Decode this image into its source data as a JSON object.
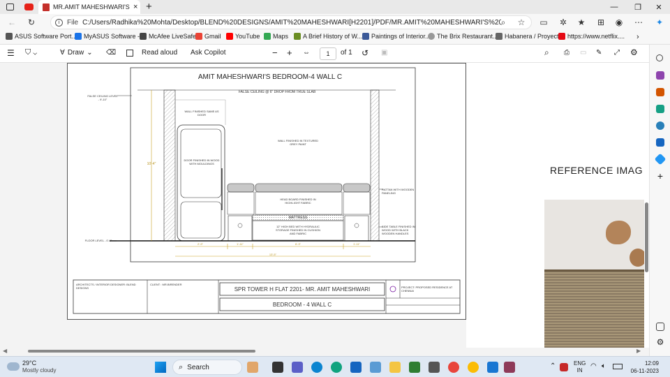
{
  "window": {
    "tab_title": "MR.AMIT MAHESHWARI'S BEDR...",
    "tab_close": "×",
    "new_tab": "+"
  },
  "address": {
    "file_label": "File",
    "url": "C:/Users/Radhika%20Mohta/Desktop/BLEND%20DESIGNS/AMIT%20MAHESHWARI[H2201]/PDF/MR.AMIT%20MAHESHWARI'S%20BEDROOM-4.pdf"
  },
  "bookmarks": [
    {
      "label": "ASUS Software Port...",
      "color": "#555555"
    },
    {
      "label": "MyASUS Software -...",
      "color": "#1a73e8"
    },
    {
      "label": "McAfee LiveSafe",
      "color": "#444444"
    },
    {
      "label": "Gmail",
      "color": "#ea4335"
    },
    {
      "label": "YouTube",
      "color": "#ff0000"
    },
    {
      "label": "Maps",
      "color": "#34a853"
    },
    {
      "label": "A Brief History of W...",
      "color": "#6b8e23"
    },
    {
      "label": "Paintings of Interior...",
      "color": "#3b5998"
    },
    {
      "label": "The Brix Restaurant...",
      "color": "#999999"
    },
    {
      "label": "Habanera / Proyect...",
      "color": "#666666"
    },
    {
      "label": "https://www.netflix....",
      "color": "#e50914"
    }
  ],
  "pdf_toolbar": {
    "draw": "Draw",
    "read_aloud": "Read aloud",
    "ask_copilot": "Ask Copilot",
    "zoom_out": "−",
    "zoom_in": "+",
    "page": "1",
    "of_pages": "of 1"
  },
  "drawing": {
    "title": "AMIT MAHESHWARI'S BEDROOM-4 WALL C",
    "false_ceiling_note": "FALSE CEILING @ 6\" DROP FROM TRUE SLAB",
    "false_ceiling_level": "FALSE CEILING LEVEL - 9'-10\"",
    "floor_level": "FLOOR LEVEL - 0'-0\"",
    "wall_finished_door": "WALL FINISHED SAME AS DOOR",
    "door_finish": "DOOR FINISHED IN WOOD WITH MOULDINGS",
    "wall_paint": "WALL FINISHED IN TEXTURED GREY PAINT",
    "head_board": "HEAD BOARD FINISHED IN HIGHLIGHT FABRIC",
    "mattress": "MATTRESS",
    "bed": "12\" HIGH BED WITH HYDRAULIC STORAGE FINISHED IN CUSHION AND FABRIC",
    "rattan": "RATTAN WITH WOODEN PANELING",
    "side_table": "SIDE TABLE FINISHED IN WOOD WITH BLACK WOODEN HANDLES",
    "height_dim": "10'-4\"",
    "dims": [
      "2'-9\"",
      "1'-11\"",
      "6'-3\"",
      "1'-11\""
    ],
    "total_dim": "13'-5\"",
    "architect": "ARCHITECTS / INTERIOR DESIGNER: BLEND DESIGNS",
    "client": "CLIENT : MR.BIRENDER",
    "project_title": "SPR TOWER H FLAT 2201- MR. AMIT MAHESHWARI",
    "sheet_title": "BEDROOM - 4 WALL C",
    "project": "PROJECT: PROPOSED RESIDENCE AT CHENNAI"
  },
  "reference": {
    "heading": "REFERENCE IMAG"
  },
  "taskbar": {
    "temp": "29°C",
    "weather": "Mostly cloudy",
    "search": "Search",
    "lang1": "ENG",
    "lang2": "IN",
    "time": "12:09",
    "date": "06-11-2023"
  }
}
